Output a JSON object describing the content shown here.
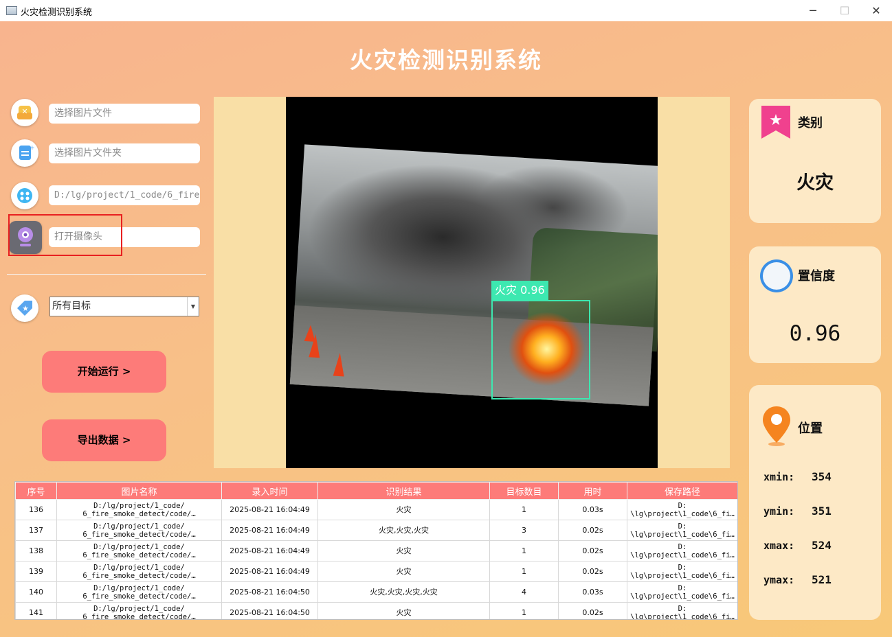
{
  "window": {
    "title": "火灾检测识别系统",
    "minimize": "─",
    "maximize": "☐",
    "close": "✕"
  },
  "app_title": "火灾检测识别系统",
  "left_panel": {
    "image_file_field": {
      "placeholder": "选择图片文件",
      "icon": "image-file-icon"
    },
    "image_folder_field": {
      "placeholder": "选择图片文件夹",
      "icon": "folder-icon"
    },
    "video_field": {
      "value": "D:/lg/project/1_code/6_fire",
      "icon": "video-icon"
    },
    "camera_field": {
      "placeholder": "打开摄像头",
      "icon": "camera-icon"
    },
    "target_select": {
      "value": "所有目标",
      "icon": "tag-icon"
    },
    "run_button": "开始运行 >",
    "export_button": "导出数据 >"
  },
  "detection": {
    "label": "火灾 0.96",
    "box_color": "#3de8b0"
  },
  "right_panel": {
    "category": {
      "title": "类别",
      "value": "火灾"
    },
    "confidence": {
      "title": "置信度",
      "value": "0.96"
    },
    "position": {
      "title": "位置",
      "xmin_label": "xmin:",
      "xmin": "354",
      "ymin_label": "ymin:",
      "ymin": "351",
      "xmax_label": "xmax:",
      "xmax": "524",
      "ymax_label": "ymax:",
      "ymax": "521"
    }
  },
  "table": {
    "headers": [
      "序号",
      "图片名称",
      "录入时间",
      "识别结果",
      "目标数目",
      "用时",
      "保存路径"
    ],
    "rows": [
      {
        "id": "136",
        "name": "D:/lg/project/1_code/\n6_fire_smoke_detect/code/…",
        "time": "2025-08-21 16:04:49",
        "result": "火灾",
        "count": "1",
        "duration": "0.03s",
        "path": "D:\n\\lg\\project\\1_code\\6_fi…"
      },
      {
        "id": "137",
        "name": "D:/lg/project/1_code/\n6_fire_smoke_detect/code/…",
        "time": "2025-08-21 16:04:49",
        "result": "火灾,火灾,火灾",
        "count": "3",
        "duration": "0.02s",
        "path": "D:\n\\lg\\project\\1_code\\6_fi…"
      },
      {
        "id": "138",
        "name": "D:/lg/project/1_code/\n6_fire_smoke_detect/code/…",
        "time": "2025-08-21 16:04:49",
        "result": "火灾",
        "count": "1",
        "duration": "0.02s",
        "path": "D:\n\\lg\\project\\1_code\\6_fi…"
      },
      {
        "id": "139",
        "name": "D:/lg/project/1_code/\n6_fire_smoke_detect/code/…",
        "time": "2025-08-21 16:04:49",
        "result": "火灾",
        "count": "1",
        "duration": "0.02s",
        "path": "D:\n\\lg\\project\\1_code\\6_fi…"
      },
      {
        "id": "140",
        "name": "D:/lg/project/1_code/\n6_fire_smoke_detect/code/…",
        "time": "2025-08-21 16:04:50",
        "result": "火灾,火灾,火灾,火灾",
        "count": "4",
        "duration": "0.03s",
        "path": "D:\n\\lg\\project\\1_code\\6_fi…"
      },
      {
        "id": "141",
        "name": "D:/lg/project/1_code/\n6_fire_smoke_detect/code/…",
        "time": "2025-08-21 16:04:50",
        "result": "火灾",
        "count": "1",
        "duration": "0.02s",
        "path": "D:\n\\lg\\project\\1_code\\6_fi…"
      }
    ]
  }
}
